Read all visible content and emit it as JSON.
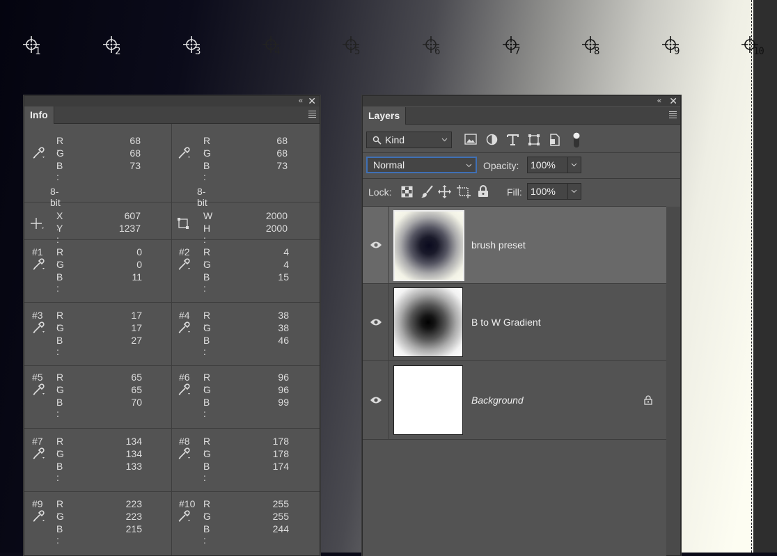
{
  "samplers": [
    "1",
    "2",
    "3",
    "4",
    "5",
    "6",
    "7",
    "8",
    "9",
    "10"
  ],
  "info": {
    "tab_label": "Info",
    "rgb_labels": {
      "r": "R :",
      "g": "G :",
      "b": "B :"
    },
    "readout_left": {
      "r": "68",
      "g": "68",
      "b": "73",
      "depth": "8-bit"
    },
    "readout_right": {
      "r": "68",
      "g": "68",
      "b": "73",
      "depth": "8-bit"
    },
    "position": {
      "x_label": "X :",
      "y_label": "Y :",
      "x": "607",
      "y": "1237"
    },
    "size": {
      "w_label": "W :",
      "h_label": "H :",
      "w": "2000",
      "h": "2000"
    },
    "samples": [
      {
        "id": "#1",
        "r": "0",
        "g": "0",
        "b": "11"
      },
      {
        "id": "#2",
        "r": "4",
        "g": "4",
        "b": "15"
      },
      {
        "id": "#3",
        "r": "17",
        "g": "17",
        "b": "27"
      },
      {
        "id": "#4",
        "r": "38",
        "g": "38",
        "b": "46"
      },
      {
        "id": "#5",
        "r": "65",
        "g": "65",
        "b": "70"
      },
      {
        "id": "#6",
        "r": "96",
        "g": "96",
        "b": "99"
      },
      {
        "id": "#7",
        "r": "134",
        "g": "134",
        "b": "133"
      },
      {
        "id": "#8",
        "r": "178",
        "g": "178",
        "b": "174"
      },
      {
        "id": "#9",
        "r": "223",
        "g": "223",
        "b": "215"
      },
      {
        "id": "#10",
        "r": "255",
        "g": "255",
        "b": "244"
      }
    ]
  },
  "layers": {
    "tab_label": "Layers",
    "filter_kind": "Kind",
    "blend_mode": "Normal",
    "opacity_label": "Opacity:",
    "opacity_value": "100%",
    "lock_label": "Lock:",
    "fill_label": "Fill:",
    "fill_value": "100%",
    "items": [
      {
        "name": "brush preset",
        "selected": true
      },
      {
        "name": "B to W Gradient",
        "selected": false
      },
      {
        "name": "Background",
        "selected": false,
        "locked": true
      }
    ]
  }
}
